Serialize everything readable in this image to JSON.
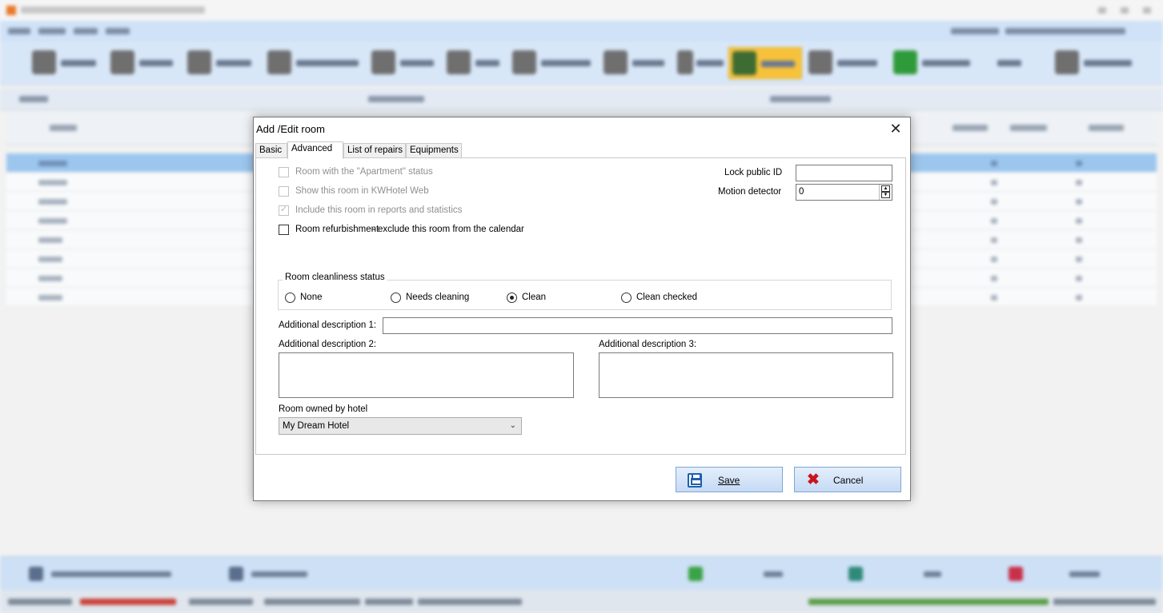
{
  "dialog": {
    "title": "Add /Edit room",
    "close_glyph": "✕",
    "tabs": [
      {
        "label": "Basic"
      },
      {
        "label": "Advanced"
      },
      {
        "label": "List of repairs"
      },
      {
        "label": "Equipments"
      }
    ],
    "active_tab": "Advanced",
    "advanced": {
      "apartment_label": "Room with the \"Apartment\" status",
      "apartment_checked": false,
      "web_label": "Show this room in KWHotel Web",
      "web_checked": false,
      "reports_label": "Include this room in reports and statistics",
      "reports_checked": true,
      "refurbishment_label": "Room refurbishment",
      "refurbishment_note": " - exclude this room from the calendar",
      "refurbishment_checked": false,
      "lock_public_id_label": "Lock public ID",
      "lock_public_id_value": "",
      "motion_detector_label": "Motion detector",
      "motion_detector_value": "0",
      "cleanliness_title": "Room cleanliness status",
      "cleanliness_options": [
        {
          "label": "None",
          "selected": false
        },
        {
          "label": "Needs cleaning",
          "selected": false
        },
        {
          "label": "Clean",
          "selected": true
        },
        {
          "label": "Clean checked",
          "selected": false
        }
      ],
      "desc1_label": "Additional description 1:",
      "desc1_value": "",
      "desc2_label": "Additional description 2:",
      "desc2_value": "",
      "desc3_label": "Additional description 3:",
      "desc3_value": "",
      "owner_label": "Room owned by hotel",
      "owner_value": "My Dream Hotel"
    },
    "buttons": {
      "save_label": "Save",
      "cancel_label": "Cancel"
    }
  },
  "colors": {
    "toolbar_active": "#f7c23a",
    "selected_row": "#9cc6ee",
    "menubar": "#cfe2f8",
    "button_border": "#7ea6d6",
    "cancel_icon": "#c8161d",
    "save_icon": "#1f5fae"
  },
  "icons": {
    "save": "save-disk-icon",
    "cancel": "cancel-x-icon",
    "dropdown": "chevron-down-icon",
    "spinner": "up-down-spinner-icon"
  }
}
